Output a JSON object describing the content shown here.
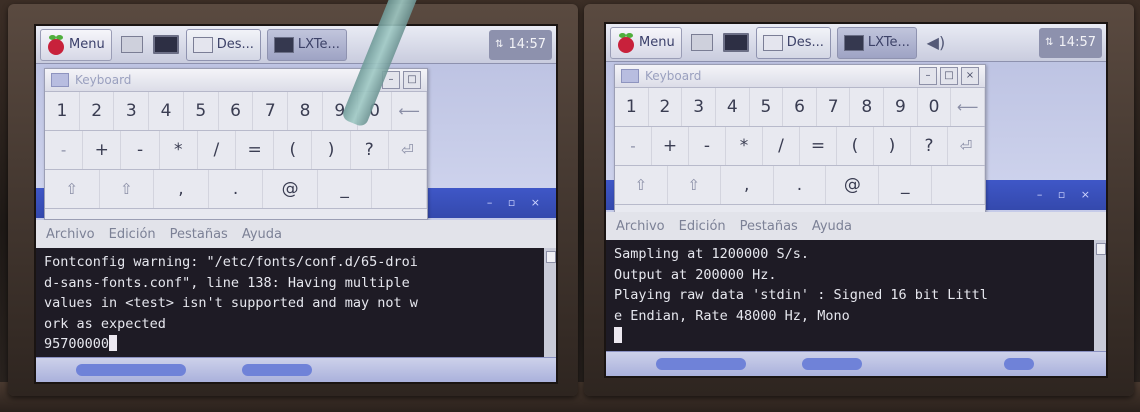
{
  "screens": [
    {
      "panel": {
        "menu_label": "Menu",
        "tasks": [
          "Des...",
          "LXTe..."
        ],
        "tray_net": "⇅",
        "clock": "14:57",
        "has_volume": false
      },
      "keyboard": {
        "title": "Keyboard",
        "controls": [
          "–",
          "□"
        ],
        "rows": [
          [
            "1",
            "2",
            "3",
            "4",
            "5",
            "6",
            "7",
            "8",
            "9",
            "0",
            "⟵"
          ],
          [
            "-",
            "+",
            "-",
            "*",
            "/",
            "=",
            "(",
            ")",
            "?",
            "⏎"
          ],
          [
            "⇧",
            "⇧",
            ",",
            ".",
            "@",
            "_",
            ""
          ]
        ]
      },
      "terminal": {
        "menu": [
          "Archivo",
          "Edición",
          "Pestañas",
          "Ayuda"
        ],
        "lines": [
          "Fontconfig warning: \"/etc/fonts/conf.d/65-droi",
          "d-sans-fonts.conf\", line 138: Having multiple",
          "values in <test> isn't supported and may not w",
          "ork as expected",
          "95700000"
        ]
      }
    },
    {
      "panel": {
        "menu_label": "Menu",
        "tasks": [
          "Des...",
          "LXTe..."
        ],
        "tray_net": "⇅",
        "clock": "14:57",
        "has_volume": true
      },
      "keyboard": {
        "title": "Keyboard",
        "controls": [
          "–",
          "□",
          "×"
        ],
        "rows": [
          [
            "1",
            "2",
            "3",
            "4",
            "5",
            "6",
            "7",
            "8",
            "9",
            "0",
            "⟵"
          ],
          [
            "-",
            "+",
            "-",
            "*",
            "/",
            "=",
            "(",
            ")",
            "?",
            "⏎"
          ],
          [
            "⇧",
            "⇧",
            ",",
            ".",
            "@",
            "_",
            ""
          ]
        ]
      },
      "terminal": {
        "menu": [
          "Archivo",
          "Edición",
          "Pestañas",
          "Ayuda"
        ],
        "lines": [
          "Sampling at 1200000 S/s.",
          "Output at 200000 Hz.",
          "Playing raw data 'stdin' : Signed 16 bit Littl",
          "e Endian, Rate 48000 Hz, Mono",
          ""
        ]
      }
    }
  ]
}
